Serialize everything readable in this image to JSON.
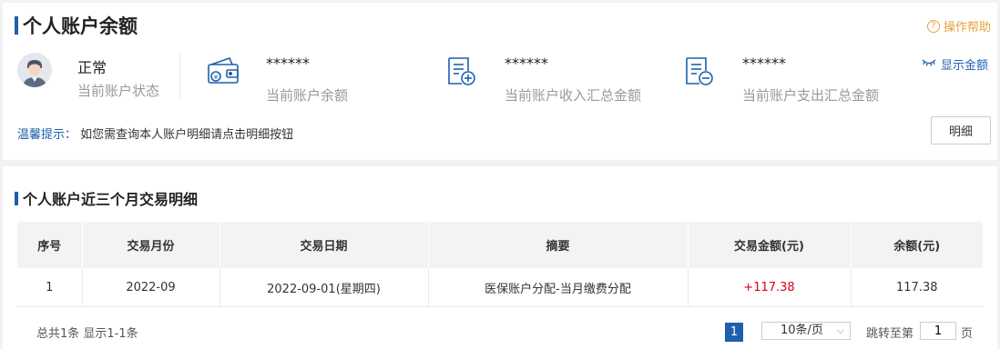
{
  "balance_card": {
    "title": "个人账户余额",
    "help_label": "操作帮助",
    "help_icon": "?",
    "show_amount_label": "显示金额",
    "status": {
      "value": "正常",
      "label": "当前账户状态"
    },
    "balance": {
      "value": "******",
      "label": "当前账户余额"
    },
    "income_total": {
      "value": "******",
      "label": "当前账户收入汇总金额"
    },
    "expense_total": {
      "value": "******",
      "label": "当前账户支出汇总金额"
    },
    "tip_label": "温馨提示：",
    "tip_text": "如您需查询本人账户明细请点击明细按钮",
    "detail_button": "明细"
  },
  "transactions": {
    "title": "个人账户近三个月交易明细",
    "columns": [
      "序号",
      "交易月份",
      "交易日期",
      "摘要",
      "交易金额(元)",
      "余额(元)"
    ],
    "rows": [
      {
        "no": "1",
        "month": "2022-09",
        "date": "2022-09-01(星期四)",
        "summary": "医保账户分配-当月缴费分配",
        "amount": "+117.38",
        "balance": "117.38"
      }
    ]
  },
  "pagination": {
    "summary": "总共1条 显示1-1条",
    "current_page": "1",
    "page_size": "10条/页",
    "jump_prefix": "跳转至第",
    "jump_value": "1",
    "jump_suffix": "页"
  },
  "colors": {
    "accent": "#1f5fae",
    "help": "#e6a23c",
    "positive_amount": "#d9001b"
  }
}
